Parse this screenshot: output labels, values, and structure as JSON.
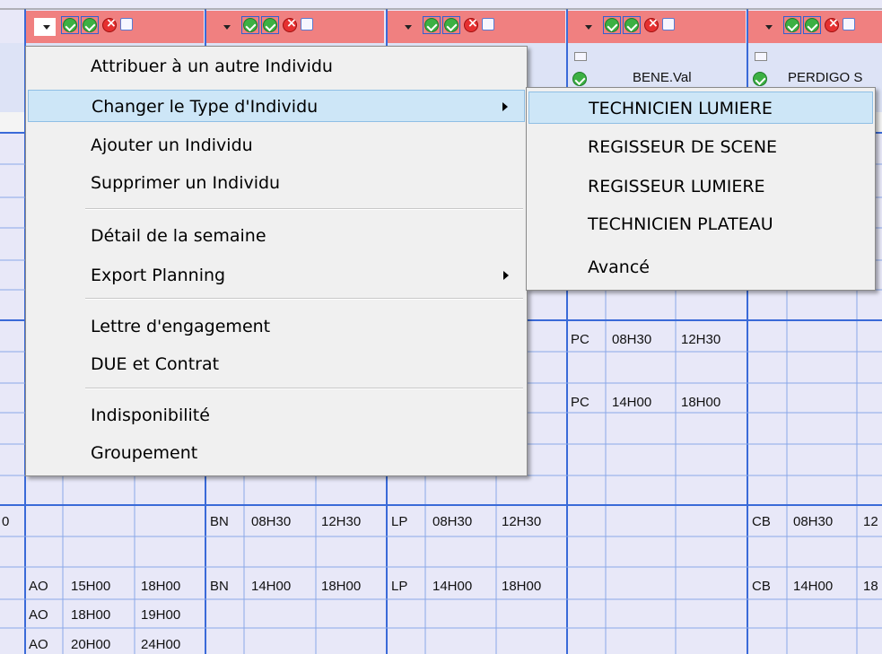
{
  "individuals": [
    {
      "name": "BENE.Val"
    },
    {
      "name": "PERDIGO S"
    }
  ],
  "grid_rows": [
    {
      "cells": [
        {
          "col": "c3a",
          "text": "PC"
        },
        {
          "col": "c3b",
          "text": "08H30"
        },
        {
          "col": "c3c",
          "text": "12H30"
        }
      ]
    },
    {
      "cells": [
        {
          "col": "c3a",
          "text": "PC"
        },
        {
          "col": "c3b",
          "text": "14H00"
        },
        {
          "col": "c3c",
          "text": "18H00"
        }
      ]
    },
    {
      "cells": [
        {
          "col": "c0",
          "text": "0"
        },
        {
          "col": "c1a",
          "text": "BN"
        },
        {
          "col": "c1b",
          "text": "08H30"
        },
        {
          "col": "c1c",
          "text": "12H30"
        },
        {
          "col": "c2a",
          "text": "LP"
        },
        {
          "col": "c2b",
          "text": "08H30"
        },
        {
          "col": "c2c",
          "text": "12H30"
        },
        {
          "col": "c4a",
          "text": "CB"
        },
        {
          "col": "c4b",
          "text": "08H30"
        },
        {
          "col": "c4c",
          "text": "12"
        }
      ]
    },
    {
      "cells": [
        {
          "col": "c0a",
          "text": "AO"
        },
        {
          "col": "c0b",
          "text": "15H00"
        },
        {
          "col": "c0c",
          "text": "18H00"
        },
        {
          "col": "c1a",
          "text": "BN"
        },
        {
          "col": "c1b",
          "text": "14H00"
        },
        {
          "col": "c1c",
          "text": "18H00"
        },
        {
          "col": "c2a",
          "text": "LP"
        },
        {
          "col": "c2b",
          "text": "14H00"
        },
        {
          "col": "c2c",
          "text": "18H00"
        },
        {
          "col": "c4a",
          "text": "CB"
        },
        {
          "col": "c4b",
          "text": "14H00"
        },
        {
          "col": "c4c",
          "text": "18"
        }
      ]
    },
    {
      "cells": [
        {
          "col": "c0a",
          "text": "AO"
        },
        {
          "col": "c0b",
          "text": "18H00"
        },
        {
          "col": "c0c",
          "text": "19H00"
        }
      ]
    },
    {
      "cells": [
        {
          "col": "c0a",
          "text": "AO"
        },
        {
          "col": "c0b",
          "text": "20H00"
        },
        {
          "col": "c0c",
          "text": "24H00"
        }
      ]
    }
  ],
  "context_menu": {
    "items": [
      {
        "label": "Attribuer à un autre Individu"
      },
      {
        "label": "Changer le Type d'Individu",
        "submenu": true,
        "highlighted": true
      },
      {
        "label": "Ajouter un Individu"
      },
      {
        "label": "Supprimer un Individu"
      },
      {
        "label": "Détail de la semaine"
      },
      {
        "label": "Export Planning",
        "submenu": true
      },
      {
        "label": "Lettre d'engagement"
      },
      {
        "label": "DUE et Contrat"
      },
      {
        "label": "Indisponibilité"
      },
      {
        "label": "Groupement"
      }
    ]
  },
  "type_submenu": {
    "items": [
      {
        "label": "TECHNICIEN LUMIERE",
        "highlighted": true
      },
      {
        "label": "REGISSEUR DE SCENE"
      },
      {
        "label": "REGISSEUR LUMIERE"
      },
      {
        "label": "TECHNICIEN PLATEAU"
      },
      {
        "label": "Avancé"
      }
    ]
  },
  "icons": {
    "dropdown": "chevron-down-icon",
    "validate": "check-circle-icon",
    "delete": "close-circle-icon",
    "detail": "document-icon",
    "submenu": "chevron-right-icon"
  },
  "colors": {
    "header_bg": "#f08080",
    "grid_bg": "#e8e8f8",
    "grid_line_major": "#3a6ad8",
    "grid_line_minor": "#8aa8e8",
    "menu_highlight": "#cde6f7"
  }
}
